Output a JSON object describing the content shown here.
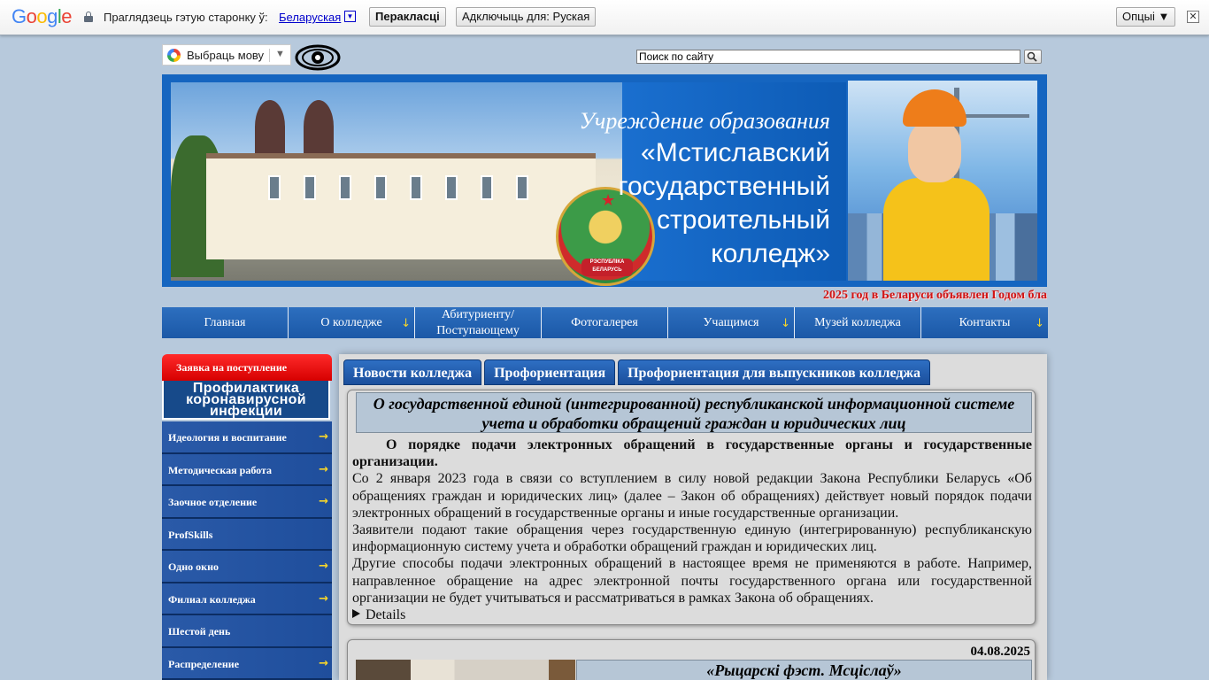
{
  "translate_bar": {
    "logo": "Google",
    "prompt": "Праглядзець гэтую старонку ў:",
    "language": "Беларуская",
    "translate_button": "Перакласці",
    "disable_button": "Адключыць для: Руская",
    "options_button": "Опцыі ▼",
    "close": "✕"
  },
  "header": {
    "language_select": "Выбраць мову",
    "language_arrow": "▼",
    "search_placeholder": "Поиск по сайту",
    "accessibility_icon": "eye-icon"
  },
  "banner": {
    "line1": "Учреждение образования",
    "line2": "«Мстиславский",
    "line3": "государственный",
    "line4": "строительный",
    "line5": "колледж»",
    "emblem_text": "РЭСПУБЛІКА БЕЛАРУСЬ"
  },
  "ticker": "2025 год в Беларуси объявлен Годом бла",
  "nav": [
    {
      "label": "Главная",
      "arrow": ""
    },
    {
      "label": "О колледже",
      "arrow": "↓"
    },
    {
      "label": "Абитуриенту/ Поступающему",
      "arrow": ""
    },
    {
      "label": "Фотогалерея",
      "arrow": ""
    },
    {
      "label": "Учащимся",
      "arrow": "↓"
    },
    {
      "label": "Музей колледжа",
      "arrow": ""
    },
    {
      "label": "Контакты",
      "arrow": "↓"
    }
  ],
  "sidebar": {
    "apply": "Заявка на поступление",
    "covid_l1": "Профилактика",
    "covid_l2": "коронавирусной",
    "covid_l3": "инфекции",
    "items": [
      {
        "label": "Идеология и воспитание",
        "arrow": "→"
      },
      {
        "label": "Методическая работа",
        "arrow": "→"
      },
      {
        "label": "Заочное отделение",
        "arrow": "→"
      },
      {
        "label": "ProfSkills",
        "arrow": ""
      },
      {
        "label": "Одно окно",
        "arrow": "→"
      },
      {
        "label": "Филиал колледжа",
        "arrow": "→"
      },
      {
        "label": "Шестой день",
        "arrow": ""
      },
      {
        "label": "Распределение",
        "arrow": "→"
      }
    ]
  },
  "tabs": [
    "Новости колледжа",
    "Профориентация",
    "Профориентация для выпускников колледжа"
  ],
  "news": {
    "title": "О государственной единой (интегрированной) республиканской информационной системе учета и обработки обращений граждан и юридических лиц",
    "lead": "О порядке подачи электронных обращений в государственные органы и государственные организации.",
    "p1": "Со 2 января 2023 года в связи со вступлением в силу новой редакции Закона Республики Беларусь «Об обращениях граждан и юридических лиц» (далее – Закон об обращениях) действует новый порядок подачи электронных обращений в государственные органы и иные государственные организации.",
    "p2": "Заявители подают такие обращения через государственную единую (интегрированную) республиканскую информационную систему учета и обработки обращений граждан и юридических лиц.",
    "p3": "Другие способы подачи электронных обращений в настоящее время не применяются в работе. Например, направленное обращение на адрес электронной почты государственного органа или государственной организации не будет учитываться и рассматриваться в рамках Закона об обращениях.",
    "details": "Details"
  },
  "news2": {
    "date": "04.08.2025",
    "title": "«Рыцарскі фэст. Мсціслаў»"
  }
}
